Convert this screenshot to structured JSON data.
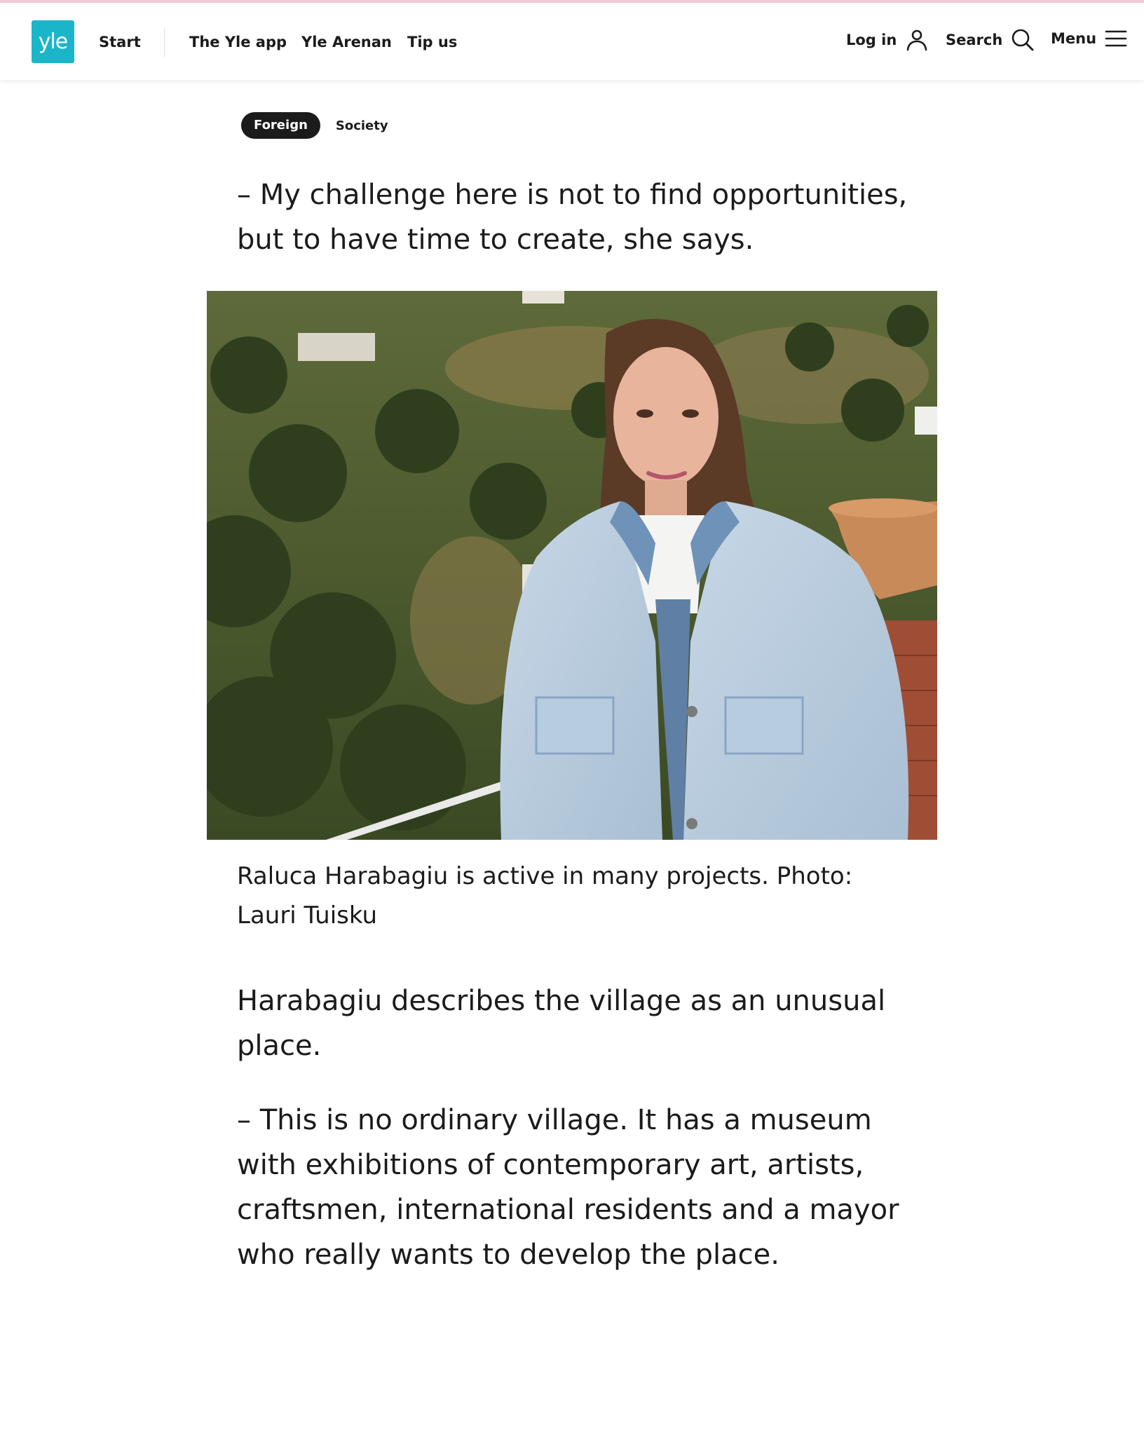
{
  "header": {
    "logo_text": "yle",
    "nav": {
      "start": "Start",
      "yle_app": "The Yle app",
      "yle_arenan": "Yle Arenan",
      "tip_us": "Tip us"
    },
    "utility": {
      "login": "Log in",
      "search": "Search",
      "menu": "Menu"
    },
    "icons": [
      "user-icon",
      "search-icon",
      "menu-icon"
    ]
  },
  "article": {
    "tags": {
      "primary": "Foreign",
      "secondary": "Society"
    },
    "quote1": "– My challenge here is not to find opportunities, but to have time to create, she says.",
    "photo_caption": "Raluca Harabagiu is active in many projects. Photo: Lauri Tuisku",
    "para1": "Harabagiu describes the village as an unusual place.",
    "para2": "– This is no ordinary village. It has a museum with exhibitions of contemporary art, artists, craftsmen, international residents and a mayor who really wants to develop the place."
  },
  "colors": {
    "brand": "#1ab5c8",
    "top_accent": "#f0c7d6",
    "text": "#1b1b1b",
    "tag_active_bg": "#1b1b1b"
  }
}
